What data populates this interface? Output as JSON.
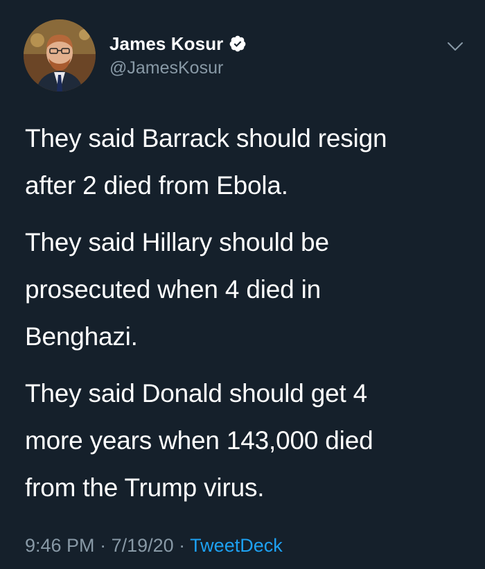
{
  "tweet": {
    "author": {
      "display_name": "James Kosur",
      "handle": "@JamesKosur",
      "verified": true
    },
    "paragraphs": [
      "They said Barrack should resign\nafter 2 died from Ebola.",
      "They said Hillary should be\nprosecuted when 4 died in\nBenghazi.",
      "They said Donald should get 4\nmore years when 143,000 died\nfrom the Trump virus."
    ],
    "meta": {
      "time": "9:46 PM",
      "separator": " · ",
      "date": "7/19/20",
      "source": "TweetDeck"
    }
  },
  "colors": {
    "background": "#15202b",
    "text_primary": "#ffffff",
    "text_secondary": "#8899a6",
    "accent": "#1da1f2"
  },
  "icons": {
    "verified": "verified-badge-icon",
    "menu": "chevron-down-icon"
  }
}
